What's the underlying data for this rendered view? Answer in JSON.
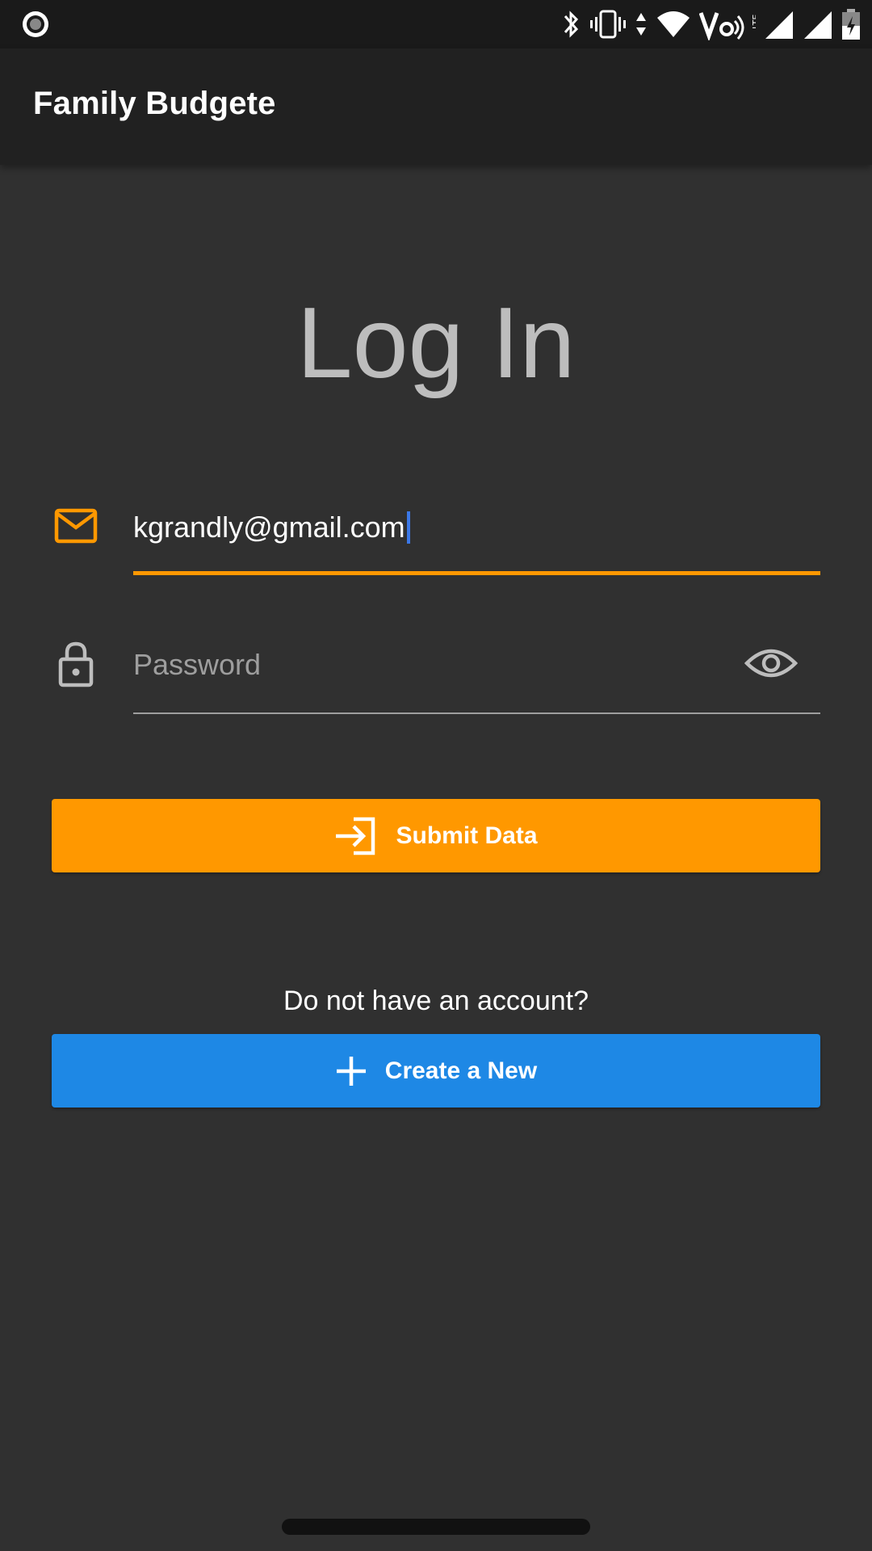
{
  "app": {
    "title": "Family Budgete"
  },
  "login": {
    "heading": "Log In",
    "email_value": "kgrandly@gmail.com",
    "password_placeholder": "Password",
    "submit_label": "Submit Data",
    "no_account_text": "Do not have an account?",
    "create_label": "Create a New"
  },
  "icons": {
    "email": "mail-icon",
    "password": "lock-icon",
    "visibility": "eye-icon",
    "submit": "login-arrow-icon",
    "create": "plus-icon"
  },
  "colors": {
    "accent": "#ff9800",
    "primary_button": "#1e88e5",
    "background": "#303030",
    "app_bar": "#212121"
  }
}
